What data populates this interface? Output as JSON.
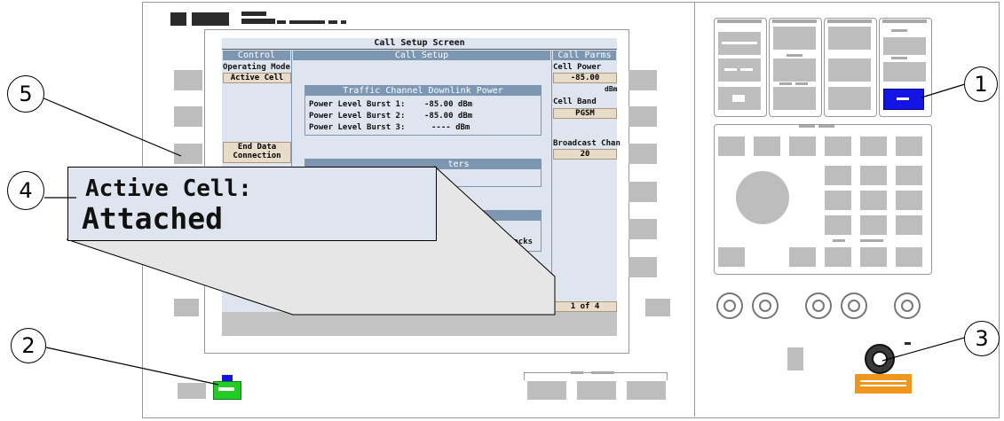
{
  "screen": {
    "title": "Call Setup Screen",
    "control_header": "Control",
    "call_setup_header": "Call Setup",
    "call_parms_header": "Call Parms",
    "operating_mode_label": "Operating Mode",
    "operating_mode_value": "Active Cell",
    "end_data_connection": "End Data Connection",
    "traffic_channel_title": "Traffic Channel Downlink Power",
    "power_rows": [
      {
        "label": "Power Level Burst 1:",
        "value": "-85.00 dBm"
      },
      {
        "label": "Power Level Burst 2:",
        "value": "-85.00 dBm"
      },
      {
        "label": "Power Level Burst 3:",
        "value": "---- dBm"
      }
    ],
    "counters_fragment": "ters",
    "locks_fragment": "locks",
    "cell_power_label": "Cell Power",
    "cell_power_value": "-85.00",
    "cell_power_unit": "dBm",
    "cell_band_label": "Cell Band",
    "cell_band_value": "PGSM",
    "broadcast_chan_label": "Broadcast Chan",
    "broadcast_chan_value": "20",
    "page_indicator": "1 of 4"
  },
  "zoom": {
    "line1": "Active Cell:",
    "line2": "Attached"
  },
  "callouts": [
    "1",
    "2",
    "3",
    "4",
    "5"
  ],
  "colors": {
    "screen_bg": "#dfe5ee",
    "header": "#7d97b3",
    "value_bg": "#e8dcc8",
    "highlight_key": "#1414e6",
    "power_key": "#22cc22",
    "rf_label": "#f0961e"
  }
}
